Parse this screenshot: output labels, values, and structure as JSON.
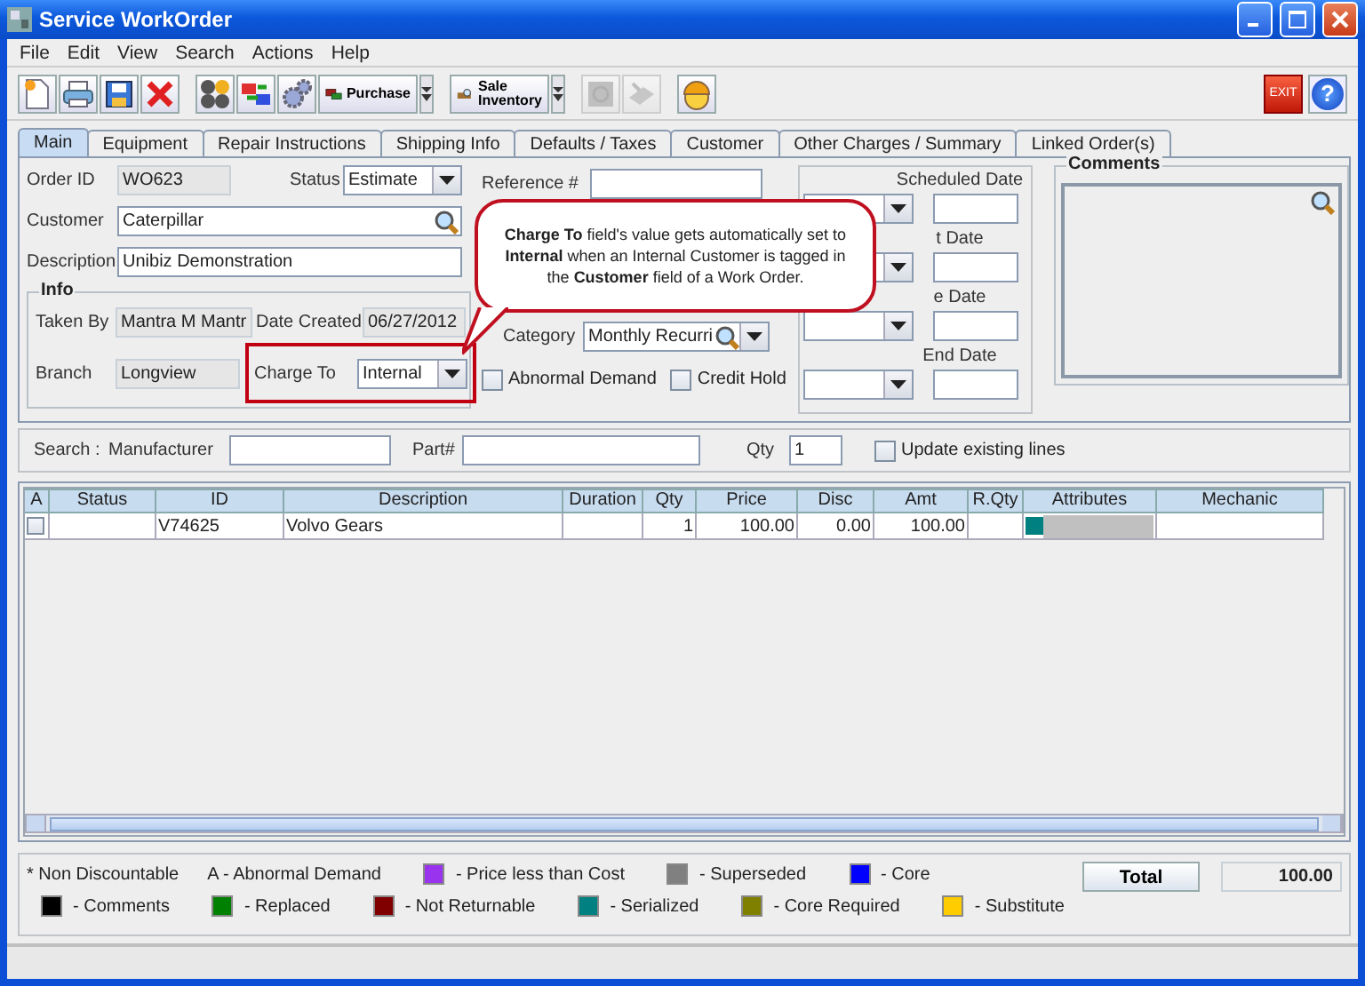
{
  "window": {
    "title": "Service WorkOrder"
  },
  "menu": [
    "File",
    "Edit",
    "View",
    "Search",
    "Actions",
    "Help"
  ],
  "toolbar": [
    {
      "kind": "icon",
      "disabled": false
    },
    {
      "kind": "icon",
      "disabled": false
    },
    {
      "kind": "icon",
      "disabled": false
    },
    {
      "kind": "icon",
      "disabled": false
    },
    {
      "kind": "gap"
    },
    {
      "kind": "icon",
      "disabled": false
    },
    {
      "kind": "icon",
      "disabled": false
    },
    {
      "kind": "icon",
      "disabled": false
    },
    {
      "kind": "menu",
      "label": "Purchase"
    },
    {
      "kind": "gap"
    },
    {
      "kind": "menu",
      "label": "Sale Inventory"
    },
    {
      "kind": "gap"
    },
    {
      "kind": "icon",
      "disabled": true
    },
    {
      "kind": "icon",
      "disabled": true
    },
    {
      "kind": "gap"
    },
    {
      "kind": "icon",
      "disabled": false
    }
  ],
  "toolbar_right": [
    {
      "kind": "exit",
      "label": "EXIT"
    },
    {
      "kind": "help",
      "label": "?"
    }
  ],
  "tabs": [
    {
      "label": "Main",
      "selected": true
    },
    {
      "label": "Equipment",
      "selected": false
    },
    {
      "label": "Repair Instructions",
      "selected": false
    },
    {
      "label": "Shipping Info",
      "selected": false
    },
    {
      "label": "Defaults / Taxes",
      "selected": false
    },
    {
      "label": "Customer",
      "selected": false
    },
    {
      "label": "Other Charges / Summary",
      "selected": false
    },
    {
      "label": "Linked Order(s)",
      "selected": false
    }
  ],
  "main": {
    "order_id": {
      "label": "Order ID",
      "value": "WO623"
    },
    "status": {
      "label": "Status",
      "value": "Estimate"
    },
    "customer": {
      "label": "Customer",
      "value": "Caterpillar"
    },
    "description": {
      "label": "Description",
      "value": "Unibiz Demonstration"
    },
    "info": {
      "title": "Info",
      "taken_by": {
        "label": "Taken By",
        "value": "Mantra M Mantr"
      },
      "date_created": {
        "label": "Date Created",
        "value": "06/27/2012"
      },
      "branch": {
        "label": "Branch",
        "value": "Longview"
      },
      "charge_to": {
        "label": "Charge To",
        "value": "Internal",
        "highlighted": true
      }
    },
    "reference": {
      "label": "Reference #"
    },
    "category": {
      "label": "Category",
      "value": "Monthly Recurri"
    },
    "checkboxes": [
      {
        "label": "Abnormal Demand",
        "checked": false
      },
      {
        "label": "Credit Hold",
        "checked": false
      }
    ],
    "dates": [
      {
        "label": "Scheduled Date"
      },
      {
        "label": "t Date"
      },
      {
        "label": "e Date"
      },
      {
        "label": "End Date"
      }
    ],
    "comments": {
      "title": "Comments"
    },
    "callout": {
      "text": "**Charge To** field's value gets automatically set to **Internal** when an Internal Customer is tagged in the **Customer** field of a Work Order."
    }
  },
  "search": {
    "label": "Search :",
    "manufacturer": {
      "label": "Manufacturer"
    },
    "part": {
      "label": "Part#"
    },
    "qty": {
      "label": "Qty",
      "value": "1"
    },
    "update": {
      "label": "Update existing lines",
      "checked": false
    }
  },
  "table": {
    "columns": [
      {
        "label": "A",
        "kind": "check"
      },
      {
        "label": "Status",
        "kind": "text"
      },
      {
        "label": "ID",
        "kind": "text"
      },
      {
        "label": "Description",
        "kind": "text"
      },
      {
        "label": "Duration",
        "kind": "text"
      },
      {
        "label": "Qty",
        "kind": "number"
      },
      {
        "label": "Price",
        "kind": "number"
      },
      {
        "label": "Disc",
        "kind": "number"
      },
      {
        "label": "Amt",
        "kind": "number"
      },
      {
        "label": "R.Qty",
        "kind": "number"
      },
      {
        "label": "Attributes",
        "kind": "attributes"
      },
      {
        "label": "Mechanic",
        "kind": "text"
      }
    ],
    "rows": [
      {
        "checked": false,
        "cells": [
          null,
          null,
          "V74625",
          "Volvo Gears",
          null,
          "1",
          "100.00",
          "0.00",
          "100.00",
          null,
          null,
          null
        ],
        "attributes": [
          {
            "color": "#008080"
          }
        ]
      }
    ]
  },
  "legend": [
    [
      {
        "kind": "note",
        "label": "* Non Discountable"
      },
      {
        "kind": "note",
        "label": "A - Abnormal Demand"
      },
      {
        "kind": "swatch",
        "label": "- Price less than Cost",
        "color": "#9933ee"
      },
      {
        "kind": "swatch",
        "label": "- Superseded",
        "color": "#808080"
      },
      {
        "kind": "swatch",
        "label": "- Core",
        "color": "#0000ff"
      }
    ],
    [
      {
        "kind": "swatch",
        "label": "- Comments",
        "color": "#000000"
      },
      {
        "kind": "swatch",
        "label": "- Replaced",
        "color": "#008000"
      },
      {
        "kind": "swatch",
        "label": "- Not Returnable",
        "color": "#800000"
      },
      {
        "kind": "swatch",
        "label": "- Serialized",
        "color": "#008080"
      },
      {
        "kind": "swatch",
        "label": "- Core Required",
        "color": "#808000"
      },
      {
        "kind": "swatch",
        "label": "- Substitute",
        "color": "#ffcc00"
      }
    ]
  ],
  "total": {
    "label": "Total",
    "value": "100.00"
  }
}
